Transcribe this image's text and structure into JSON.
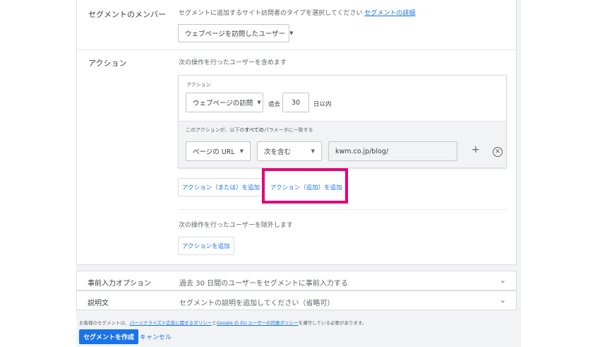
{
  "segment_members": {
    "label": "セグメントのメンバー",
    "helper": "セグメントに追加するサイト訪問者のタイプを選択してください",
    "helper_link": "セグメントの詳細",
    "dropdown_value": "ウェブページを訪問したユーザー"
  },
  "action": {
    "label": "アクション",
    "include_helper": "次の操作を行ったユーザーを含めます",
    "box_title": "アクション",
    "action_dropdown": "ウェブページの訪問",
    "past_label": "過去",
    "days_value": "30",
    "days_suffix": "日以内",
    "param_helper_prefix": "このアクションが、以下の",
    "param_helper_bold": "すべての",
    "param_helper_suffix": "パラメータに一致する",
    "param_dropdown": "ページの URL",
    "match_dropdown": "次を含む",
    "url_value": "kwm.co.jp/blog/",
    "add_or_button": "アクション（または）を追加",
    "add_and_button": "アクション（追加）を追加",
    "exclude_helper": "次の操作を行ったユーザーを除外します",
    "add_exclude_button": "アクションを追加"
  },
  "prefill": {
    "label": "事前入力オプション",
    "value": "過去 30 日間のユーザーをセグメントに事前入力する"
  },
  "description": {
    "label": "説明文",
    "placeholder": "セグメントの説明を追加してください（省略可）"
  },
  "footer": {
    "notice_prefix": "お客様のセグメントは、",
    "policy_link_1": "パーソナライズド広告に関するポリシー",
    "notice_and": "と",
    "policy_link_2": "Google の EU ユーザーの同意ポリシー",
    "notice_suffix": "を遵守している必要があります。",
    "create_button": "セグメントを作成",
    "cancel_button": "キャンセル"
  },
  "colors": {
    "accent": "#1a73e8",
    "highlight": "#e2007a"
  }
}
